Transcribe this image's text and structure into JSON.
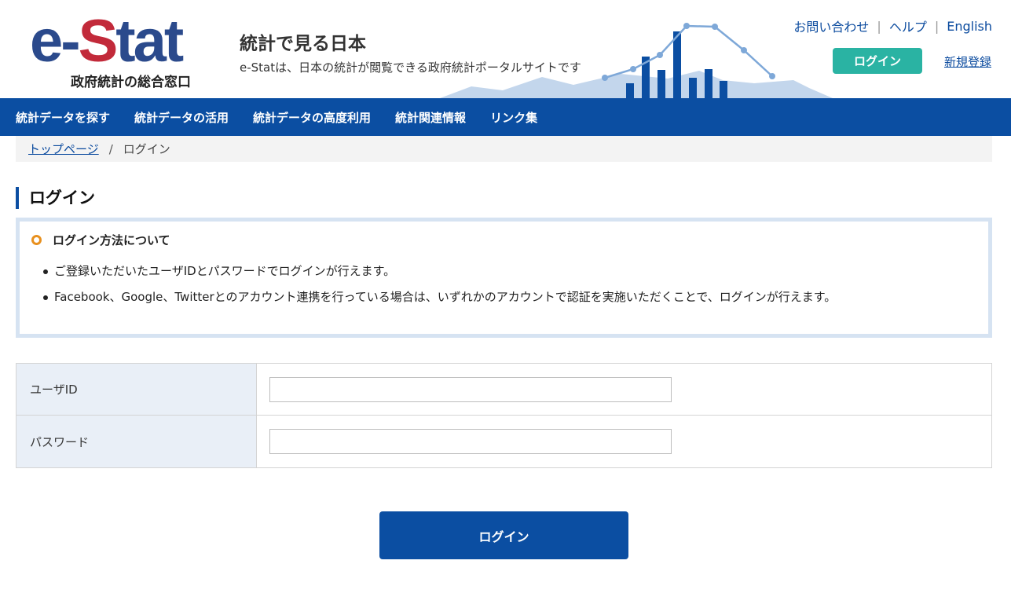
{
  "header": {
    "logo_main_left": "e-",
    "logo_main_red": "S",
    "logo_main_right": "tat",
    "logo_sub": "政府統計の総合窓口",
    "title": "統計で見る日本",
    "description": "e-Statは、日本の統計が閲覧できる政府統計ポータルサイトです",
    "links": [
      {
        "label": "お問い合わせ"
      },
      {
        "label": "ヘルプ"
      },
      {
        "label": "English"
      }
    ],
    "login_button": "ログイン",
    "register_link": "新規登録"
  },
  "nav": {
    "items": [
      {
        "label": "統計データを探す"
      },
      {
        "label": "統計データの活用"
      },
      {
        "label": "統計データの高度利用"
      },
      {
        "label": "統計関連情報"
      },
      {
        "label": "リンク集"
      }
    ]
  },
  "breadcrumb": {
    "home": "トップページ",
    "separator": "/",
    "current": "ログイン"
  },
  "page": {
    "title": "ログイン"
  },
  "info": {
    "heading": "ログイン方法について",
    "items": [
      "ご登録いただいたユーザIDとパスワードでログインが行えます。",
      "Facebook、Google、Twitterとのアカウント連携を行っている場合は、いずれかのアカウントで認証を実施いただくことで、ログインが行えます。"
    ]
  },
  "form": {
    "user_id_label": "ユーザID",
    "user_id_value": "",
    "password_label": "パスワード",
    "password_value": "",
    "submit_label": "ログイン"
  },
  "colors": {
    "brand_blue": "#0b4ea2",
    "brand_red": "#c22a3a",
    "teal": "#2ab3a3",
    "accent_orange": "#e8901e"
  }
}
